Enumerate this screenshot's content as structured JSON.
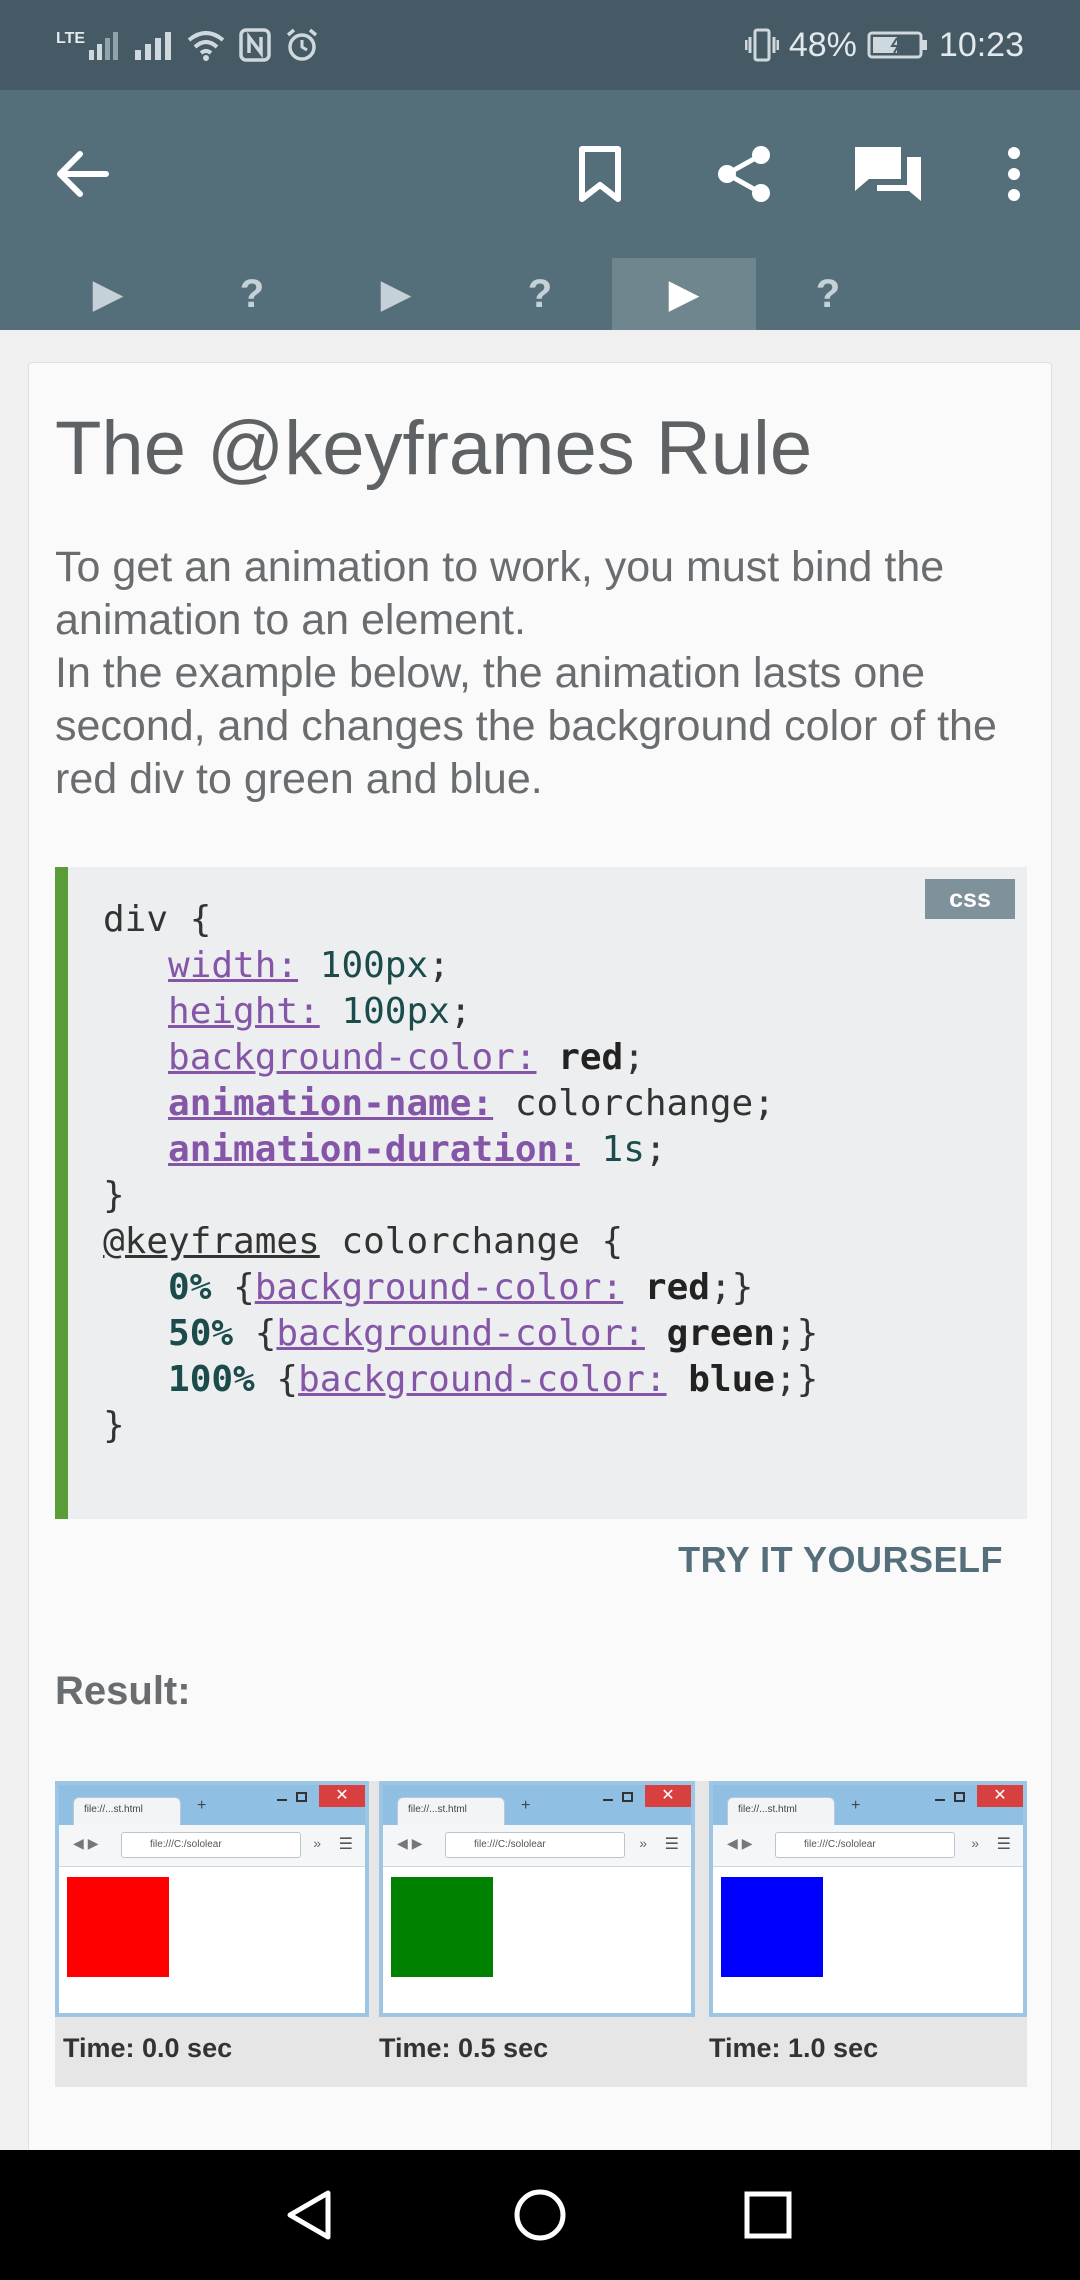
{
  "status_bar": {
    "network": "LTE",
    "battery": "48%",
    "time": "10:23"
  },
  "app_bar": {
    "icons": [
      "back-arrow-icon",
      "bookmark-icon",
      "share-icon",
      "comments-icon",
      "more-vert-icon"
    ]
  },
  "step_tabs": [
    {
      "type": "lesson",
      "label": "▶"
    },
    {
      "type": "quiz",
      "label": "?"
    },
    {
      "type": "lesson",
      "label": "▶"
    },
    {
      "type": "quiz",
      "label": "?"
    },
    {
      "type": "lesson",
      "label": "▶",
      "active": true
    },
    {
      "type": "quiz",
      "label": "?"
    }
  ],
  "lesson": {
    "title": "The @keyframes Rule",
    "paragraph_1": "To get an animation to work, you must bind the animation to an element.",
    "paragraph_2": "In the example below, the animation lasts one second, and changes the background color of the red div to green and blue.",
    "code_language": "css",
    "try_label": "TRY IT YOURSELF",
    "result_label": "Result:"
  },
  "result_frames": [
    {
      "tab": "file://...st.html",
      "url": "file:///C:/sololear",
      "color": "#ff0000",
      "time": "Time: 0.0 sec"
    },
    {
      "tab": "file://...st.html",
      "url": "file:///C:/sololear",
      "color": "#008000",
      "time": "Time: 0.5 sec"
    },
    {
      "tab": "file://...st.html",
      "url": "file:///C:/sololear",
      "color": "#0000ff",
      "time": "Time: 1.0 sec"
    }
  ],
  "colors": {
    "status_bar": "#455a64",
    "app_bar": "#546e7a",
    "code_border": "#5a9c38",
    "code_bg": "#eceeef"
  }
}
